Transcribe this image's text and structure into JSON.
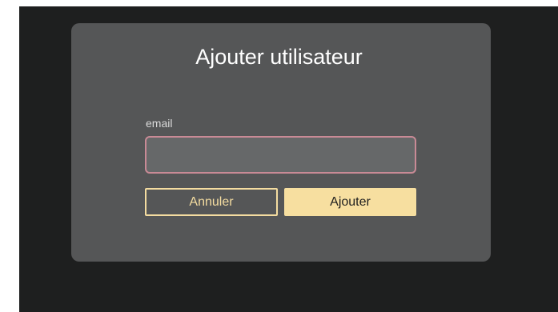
{
  "dialog": {
    "title": "Ajouter utilisateur",
    "email_label": "email",
    "email_value": "",
    "cancel_label": "Annuler",
    "submit_label": "Ajouter"
  },
  "colors": {
    "backdrop": "#1e1f1f",
    "dialog_bg": "#555657",
    "input_bg": "#666869",
    "input_border_invalid": "#c98a96",
    "accent": "#f7dfa0"
  }
}
